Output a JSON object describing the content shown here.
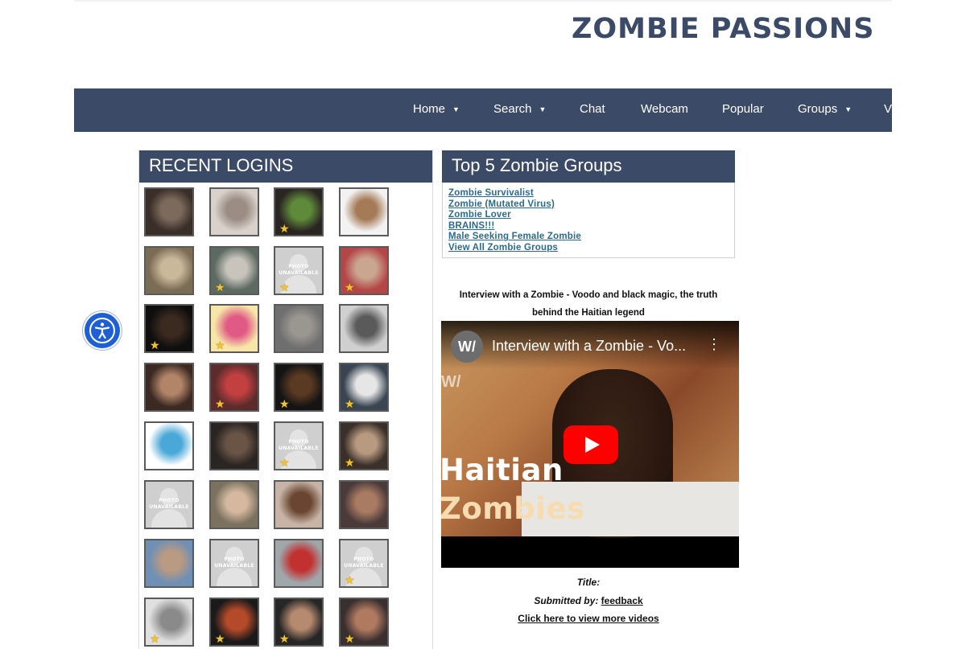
{
  "site": {
    "title": "ZOMBIE PASSIONS"
  },
  "nav": {
    "items": [
      {
        "label": "Home",
        "caret": "▼"
      },
      {
        "label": "Search",
        "caret": "▼"
      },
      {
        "label": "Chat"
      },
      {
        "label": "Webcam"
      },
      {
        "label": "Popular"
      },
      {
        "label": "Groups",
        "caret": "▼"
      },
      {
        "label": "V"
      }
    ]
  },
  "recent_logins": {
    "heading": "RECENT LOGINS",
    "photo_unavailable_text": "PHOTO UNAVAILABLE",
    "profiles": [
      {
        "photo": "man-with-cat",
        "featured": false
      },
      {
        "photo": "woman-with-glasses",
        "featured": false
      },
      {
        "photo": "man-with-cap-bird",
        "featured": true
      },
      {
        "photo": "cartoon-avatar-woman",
        "featured": false
      },
      {
        "photo": "man-in-room",
        "featured": false
      },
      {
        "photo": "man-with-glasses",
        "featured": true
      },
      {
        "photo": "unavailable",
        "featured": true
      },
      {
        "photo": "man-smiling-glasses",
        "featured": true
      },
      {
        "photo": "dark-webcam",
        "featured": true
      },
      {
        "photo": "pink-hair-drawing",
        "featured": true
      },
      {
        "photo": "bearded-man-car",
        "featured": false
      },
      {
        "photo": "man-black-white",
        "featured": false
      },
      {
        "photo": "young-man",
        "featured": false
      },
      {
        "photo": "man-in-helmet",
        "featured": true
      },
      {
        "photo": "dark-room-light",
        "featured": true
      },
      {
        "photo": "man-with-sunglasses",
        "featured": true
      },
      {
        "photo": "cartoon-avatar-man",
        "featured": false
      },
      {
        "photo": "man-dark-shirt",
        "featured": false
      },
      {
        "photo": "unavailable",
        "featured": true
      },
      {
        "photo": "bald-man",
        "featured": true
      },
      {
        "photo": "unavailable",
        "featured": false
      },
      {
        "photo": "man-with-hat",
        "featured": false
      },
      {
        "photo": "woman-smiling",
        "featured": false
      },
      {
        "photo": "zombie-makeup",
        "featured": false
      },
      {
        "photo": "man-in-sunglasses-outdoors",
        "featured": false
      },
      {
        "photo": "unavailable",
        "featured": false
      },
      {
        "photo": "person-in-red-costume",
        "featured": false
      },
      {
        "photo": "unavailable",
        "featured": true
      },
      {
        "photo": "cartoon-girl",
        "featured": true
      },
      {
        "photo": "woman-red-hair",
        "featured": true
      },
      {
        "photo": "man-with-beard",
        "featured": true
      },
      {
        "photo": "group-photo",
        "featured": true
      }
    ]
  },
  "top_groups": {
    "heading": "Top 5 Zombie Groups",
    "links": [
      "Zombie Survivalist",
      "Zombie (Mutated Virus)",
      "Zombie Lover",
      "BRAINS!!!",
      "Male Seeking Female Zombie",
      "View All Zombie Groups"
    ]
  },
  "video": {
    "caption_line1": "Interview with a Zombie - Voodo and black magic, the truth",
    "caption_line2": "behind the Haitian legend",
    "player_title": "Interview with a Zombie - Vo...",
    "channel_initials": "W/",
    "menu_icon": "⋮",
    "overlay_line1": "Haitian",
    "overlay_line2": "Zombies",
    "title_label": "Title:",
    "submitted_label": "Submitted by:",
    "submitted_by": "feedback",
    "more_link": "Click here to view more videos"
  },
  "colors": {
    "brand": "#3b4a67",
    "link": "#2a6a8f",
    "star": "#f2c230",
    "accessibility": "#1f5fd6",
    "play": "#ff0000"
  },
  "icons": {
    "accessibility": "accessibility-icon",
    "star": "star-icon",
    "play": "play-icon",
    "menu": "kebab-menu-icon",
    "caret": "chevron-down-icon"
  }
}
